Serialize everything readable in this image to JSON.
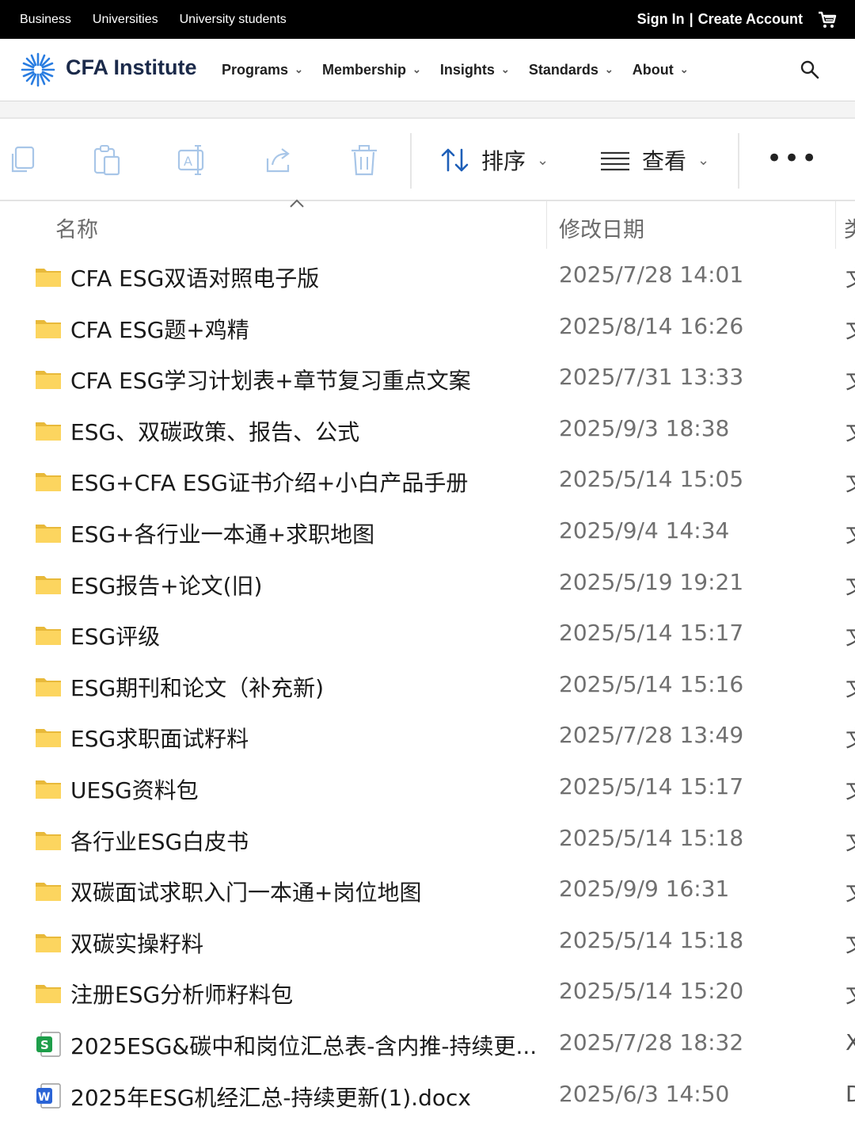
{
  "topbar": {
    "links": [
      "Business",
      "Universities",
      "University students"
    ],
    "sign_in": "Sign In",
    "separator": "|",
    "create_account": "Create Account"
  },
  "header": {
    "brand": "CFA Institute",
    "menu": [
      "Programs",
      "Membership",
      "Insights",
      "Standards",
      "About"
    ]
  },
  "toolbar": {
    "sort_label": "排序",
    "view_label": "查看",
    "more_label": "•••"
  },
  "columns": {
    "name": "名称",
    "modified": "修改日期",
    "type": "类"
  },
  "files": [
    {
      "icon": "folder-icon",
      "name": "CFA ESG双语对照电子版",
      "date": "2025/7/28 14:01",
      "type": "文"
    },
    {
      "icon": "folder-icon",
      "name": "CFA ESG题+鸡精",
      "date": "2025/8/14 16:26",
      "type": "文"
    },
    {
      "icon": "folder-icon",
      "name": "CFA ESG学习计划表+章节复习重点文案",
      "date": "2025/7/31 13:33",
      "type": "文"
    },
    {
      "icon": "folder-icon",
      "name": "ESG、双碳政策、报告、公式",
      "date": "2025/9/3 18:38",
      "type": "文"
    },
    {
      "icon": "folder-icon",
      "name": "ESG+CFA ESG证书介绍+小白产品手册",
      "date": "2025/5/14 15:05",
      "type": "文"
    },
    {
      "icon": "folder-icon",
      "name": "ESG+各行业一本通+求职地图",
      "date": "2025/9/4 14:34",
      "type": "文"
    },
    {
      "icon": "folder-icon",
      "name": "ESG报告+论文(旧)",
      "date": "2025/5/19 19:21",
      "type": "文"
    },
    {
      "icon": "folder-icon",
      "name": "ESG评级",
      "date": "2025/5/14 15:17",
      "type": "文"
    },
    {
      "icon": "folder-icon",
      "name": "ESG期刊和论文（补充新)",
      "date": "2025/5/14 15:16",
      "type": "文"
    },
    {
      "icon": "folder-icon",
      "name": "ESG求职面试籽料",
      "date": "2025/7/28 13:49",
      "type": "文"
    },
    {
      "icon": "folder-icon",
      "name": "UESG资料包",
      "date": "2025/5/14 15:17",
      "type": "文"
    },
    {
      "icon": "folder-icon",
      "name": "各行业ESG白皮书",
      "date": "2025/5/14 15:18",
      "type": "文"
    },
    {
      "icon": "folder-icon",
      "name": "双碳面试求职入门一本通+岗位地图",
      "date": "2025/9/9 16:31",
      "type": "文"
    },
    {
      "icon": "folder-icon",
      "name": "双碳实操籽料",
      "date": "2025/5/14 15:18",
      "type": "文"
    },
    {
      "icon": "folder-icon",
      "name": "注册ESG分析师籽料包",
      "date": "2025/5/14 15:20",
      "type": "文"
    },
    {
      "icon": "spreadsheet-icon",
      "name": "2025ESG&碳中和岗位汇总表-含内推-持续更...",
      "date": "2025/7/28 18:32",
      "type": "X"
    },
    {
      "icon": "word-doc-icon",
      "name": "2025年ESG机经汇总-持续更新(1).docx",
      "date": "2025/6/3 14:50",
      "type": "D"
    }
  ],
  "colors": {
    "topbar_bg": "#000000",
    "brand_navy": "#1b2a4a",
    "logo_blue": "#2a7de1",
    "folder_yellow": "#fcd55f",
    "sheet_green": "#1e9e4a",
    "word_blue": "#2b64d6"
  }
}
